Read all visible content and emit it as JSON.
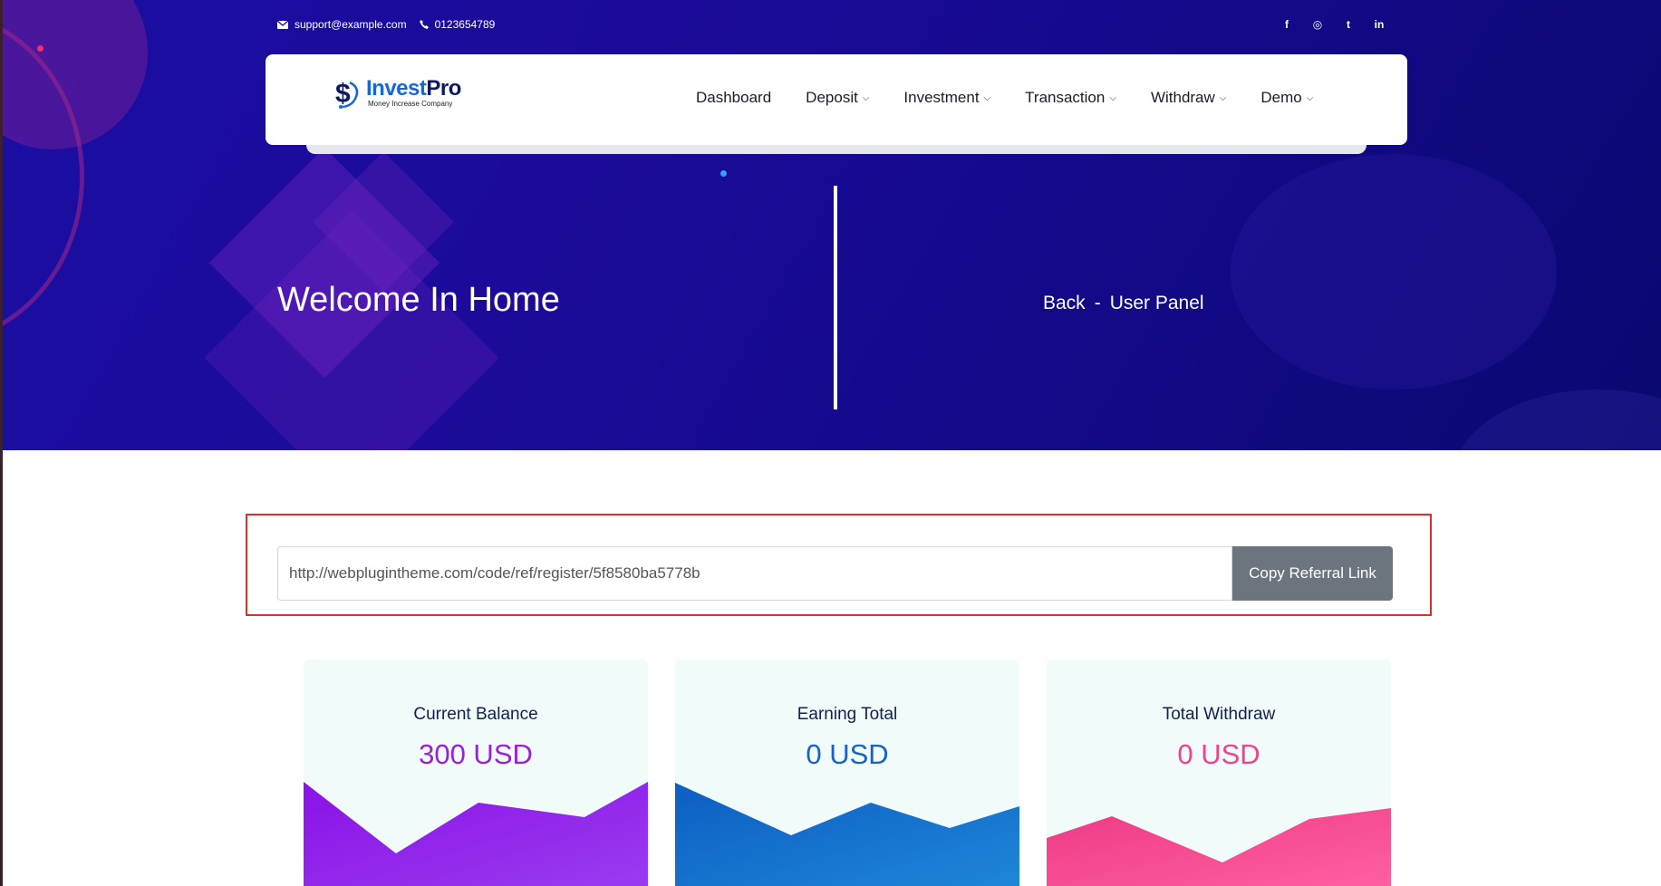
{
  "contact": {
    "email": "support@example.com",
    "phone": "0123654789"
  },
  "social": [
    "f",
    "◎",
    "t",
    "in"
  ],
  "brand": {
    "name_part1": "Invest",
    "name_part2": "Pro",
    "tagline": "Money Increase Company"
  },
  "nav": {
    "items": [
      {
        "label": "Dashboard",
        "dropdown": false
      },
      {
        "label": "Deposit",
        "dropdown": true
      },
      {
        "label": "Investment",
        "dropdown": true
      },
      {
        "label": "Transaction",
        "dropdown": true
      },
      {
        "label": "Withdraw",
        "dropdown": true
      },
      {
        "label": "Demo",
        "dropdown": true
      }
    ]
  },
  "hero": {
    "title": "Welcome In Home",
    "breadcrumb_back": "Back",
    "breadcrumb_sep": "-",
    "breadcrumb_current": "User Panel"
  },
  "referral": {
    "link": "http://webplugintheme.com/code/ref/register/5f8580ba5778b",
    "button_label": "Copy Referral Link"
  },
  "stats": [
    {
      "label": "Current Balance",
      "value": "300 USD",
      "color": "#9a1fd9"
    },
    {
      "label": "Earning Total",
      "value": "0 USD",
      "color": "#1563c4"
    },
    {
      "label": "Total Withdraw",
      "value": "0 USD",
      "color": "#f0428c"
    }
  ],
  "colors": {
    "hero_bg": "#1a0ea3",
    "referral_border": "#e42b2b",
    "button_gray": "#6c757d"
  }
}
